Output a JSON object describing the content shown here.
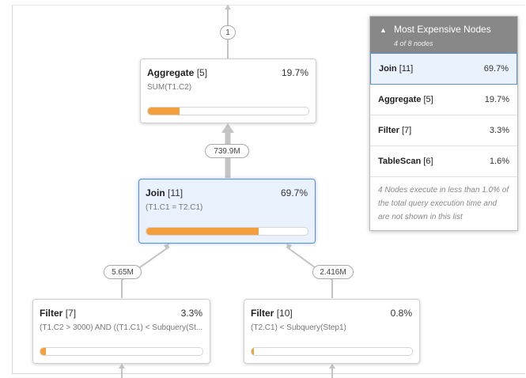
{
  "edges": {
    "top_count": "1",
    "agg_join_rows": "739.9M",
    "join_left_rows": "5.65M",
    "join_right_rows": "2.416M"
  },
  "nodes": {
    "aggregate": {
      "name": "Aggregate",
      "id": "[5]",
      "percent": "19.7%",
      "detail": "SUM(T1.C2)",
      "bar_fraction": 0.197
    },
    "join": {
      "name": "Join",
      "id": "[11]",
      "percent": "69.7%",
      "detail": "(T1.C1 = T2.C1)",
      "bar_fraction": 0.697,
      "selected": true
    },
    "filter_7": {
      "name": "Filter",
      "id": "[7]",
      "percent": "3.3%",
      "detail": "(T1.C2 > 3000) AND ((T1.C1) < Subquery(St...",
      "bar_fraction": 0.033
    },
    "filter_10": {
      "name": "Filter",
      "id": "[10]",
      "percent": "0.8%",
      "detail": "(T2.C1) < Subquery(Step1)",
      "bar_fraction": 0.008
    }
  },
  "panel": {
    "title": "Most Expensive Nodes",
    "subtitle": "4 of 8 nodes",
    "rows": [
      {
        "name": "Join",
        "id": "[11]",
        "percent": "69.7%"
      },
      {
        "name": "Aggregate",
        "id": "[5]",
        "percent": "19.7%"
      },
      {
        "name": "Filter",
        "id": "[7]",
        "percent": "3.3%"
      },
      {
        "name": "TableScan",
        "id": "[6]",
        "percent": "1.6%"
      }
    ],
    "footer": "4 Nodes execute in less than 1.0% of the total query execution time and are not shown in this list"
  },
  "colors": {
    "bar": "#f59f3c",
    "selected_border": "#5b8fd8",
    "selected_bg": "#e9f1fd",
    "panel_header": "#888888"
  }
}
